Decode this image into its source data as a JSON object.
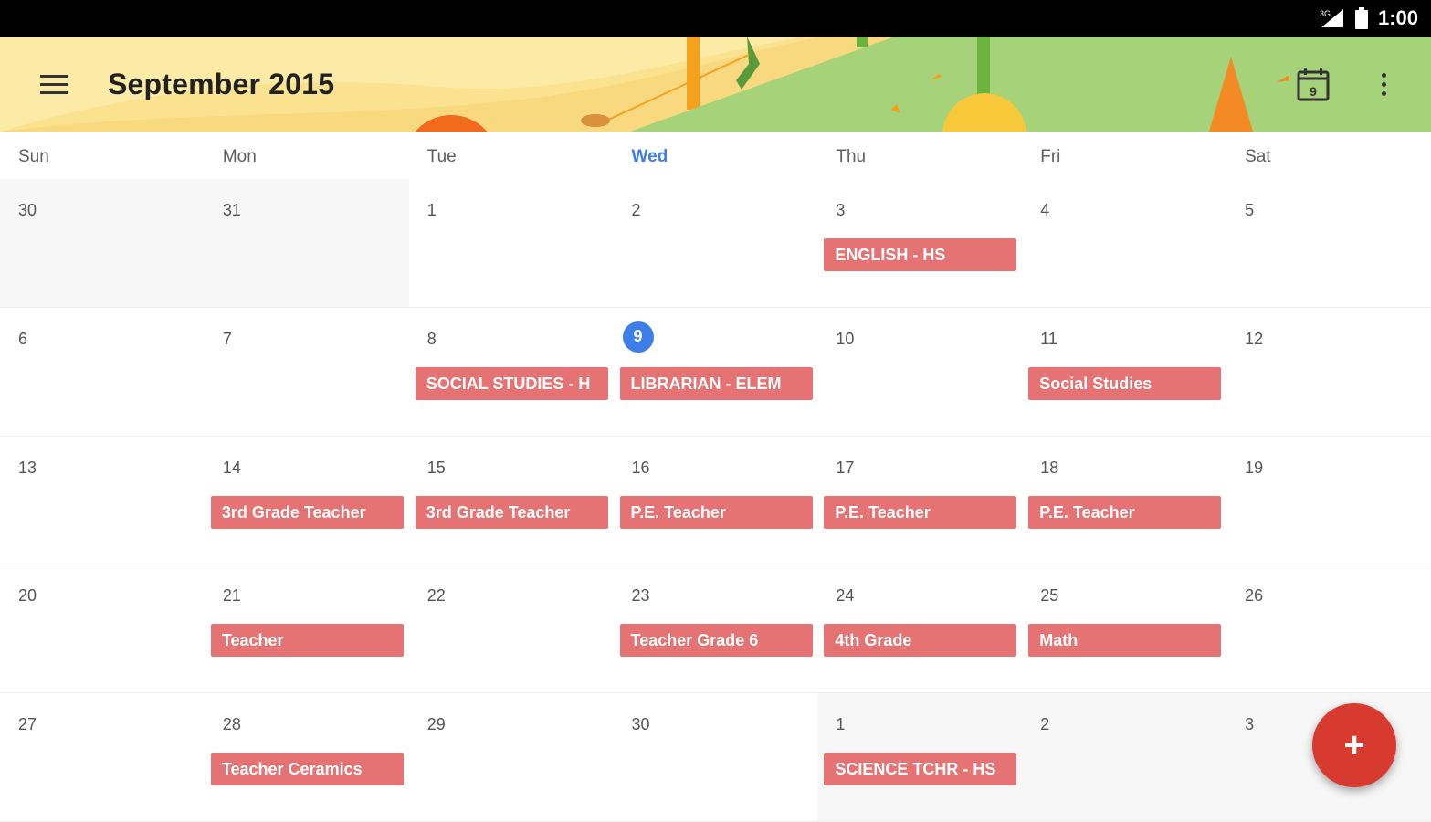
{
  "status_bar": {
    "time": "1:00",
    "icons": [
      "signal-icon",
      "battery-icon"
    ]
  },
  "header": {
    "title": "September 2015",
    "menu_icon": "menu-icon",
    "today_icon": "calendar-today-icon",
    "today_icon_day": "9",
    "overflow_icon": "more-vert-icon"
  },
  "colors": {
    "event": "#e57373",
    "today_accent": "#3d7ee8",
    "fab": "#d93a2f"
  },
  "weekdays": [
    "Sun",
    "Mon",
    "Tue",
    "Wed",
    "Thu",
    "Fri",
    "Sat"
  ],
  "weeks": [
    [
      {
        "day": "30",
        "other": true,
        "event": ""
      },
      {
        "day": "31",
        "other": true,
        "event": ""
      },
      {
        "day": "1",
        "other": false,
        "event": ""
      },
      {
        "day": "2",
        "other": false,
        "event": ""
      },
      {
        "day": "3",
        "other": false,
        "event": "ENGLISH  - HS"
      },
      {
        "day": "4",
        "other": false,
        "event": ""
      },
      {
        "day": "5",
        "other": false,
        "event": ""
      }
    ],
    [
      {
        "day": "6",
        "other": false,
        "event": ""
      },
      {
        "day": "7",
        "other": false,
        "event": ""
      },
      {
        "day": "8",
        "other": false,
        "event": "SOCIAL STUDIES - H"
      },
      {
        "day": "9",
        "other": false,
        "today": true,
        "event": "LIBRARIAN - ELEM"
      },
      {
        "day": "10",
        "other": false,
        "event": ""
      },
      {
        "day": "11",
        "other": false,
        "event": "Social Studies"
      },
      {
        "day": "12",
        "other": false,
        "event": ""
      }
    ],
    [
      {
        "day": "13",
        "other": false,
        "event": ""
      },
      {
        "day": "14",
        "other": false,
        "event": "3rd Grade Teacher"
      },
      {
        "day": "15",
        "other": false,
        "event": "3rd Grade Teacher"
      },
      {
        "day": "16",
        "other": false,
        "event": "P.E. Teacher"
      },
      {
        "day": "17",
        "other": false,
        "event": "P.E. Teacher"
      },
      {
        "day": "18",
        "other": false,
        "event": "P.E. Teacher"
      },
      {
        "day": "19",
        "other": false,
        "event": ""
      }
    ],
    [
      {
        "day": "20",
        "other": false,
        "event": ""
      },
      {
        "day": "21",
        "other": false,
        "event": "Teacher"
      },
      {
        "day": "22",
        "other": false,
        "event": ""
      },
      {
        "day": "23",
        "other": false,
        "event": "Teacher Grade 6"
      },
      {
        "day": "24",
        "other": false,
        "event": "4th Grade"
      },
      {
        "day": "25",
        "other": false,
        "event": "Math"
      },
      {
        "day": "26",
        "other": false,
        "event": ""
      }
    ],
    [
      {
        "day": "27",
        "other": false,
        "event": ""
      },
      {
        "day": "28",
        "other": false,
        "event": "Teacher Ceramics"
      },
      {
        "day": "29",
        "other": false,
        "event": ""
      },
      {
        "day": "30",
        "other": false,
        "event": ""
      },
      {
        "day": "1",
        "other": true,
        "event": "SCIENCE TCHR - HS"
      },
      {
        "day": "2",
        "other": true,
        "event": ""
      },
      {
        "day": "3",
        "other": true,
        "event": ""
      }
    ]
  ],
  "fab": {
    "label": "+",
    "icon": "add-icon"
  }
}
